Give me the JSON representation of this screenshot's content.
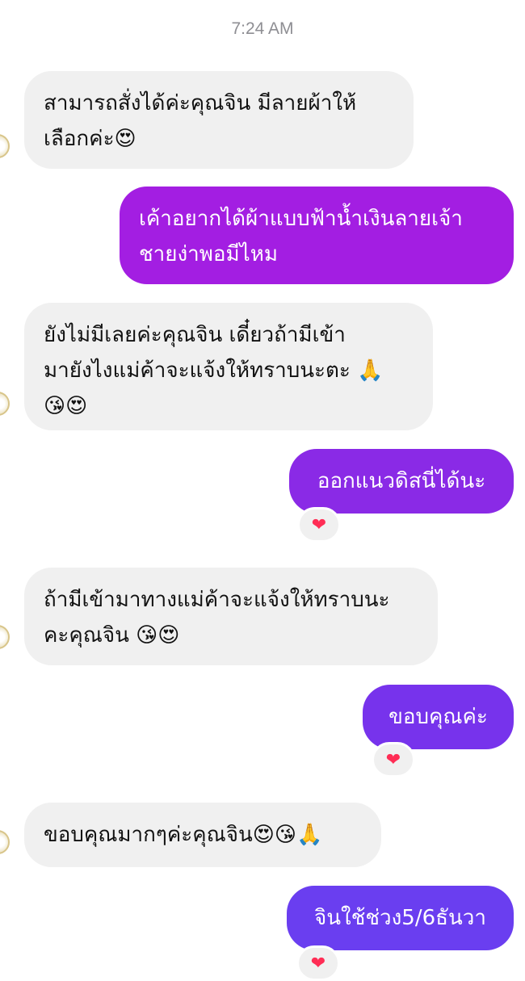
{
  "timestamp": "7:24 AM",
  "messages": [
    {
      "text": "สามารถสั่งได้ค่ะคุณจิน มีลายผ้าให้\nเลือกค่ะ😍"
    },
    {
      "text": "เค้าอยากได้ผ้าแบบฟ้าน้ำเงินลายเจ้า\nชายง่าพอมีไหม"
    },
    {
      "text": "ยังไม่มีเลยค่ะคุณจิน เดี๋ยวถ้ามีเข้า\nมายังไงแม่ค้าจะแจ้งให้ทราบนะตะ 🙏\n😘😍"
    },
    {
      "text": "ออกแนวดิสนี่ได้นะ",
      "reaction": "❤"
    },
    {
      "text": "ถ้ามีเข้ามาทางแม่ค้าจะแจ้งให้ทราบนะ\nคะคุณจิน 😘😍"
    },
    {
      "text": "ขอบคุณค่ะ",
      "reaction": "❤"
    },
    {
      "text": "ขอบคุณมากๆค่ะคุณจิน😍😘🙏"
    },
    {
      "text": "จินใช้ช่วง5/6ธันวา",
      "reaction": "❤"
    }
  ],
  "colors": {
    "incoming_bubble": "#f0f0f0",
    "outgoing_gradient": [
      "#a21fe0",
      "#6a3df0"
    ],
    "reaction_heart": "#ff2d55",
    "timestamp_text": "#8e8e93"
  }
}
